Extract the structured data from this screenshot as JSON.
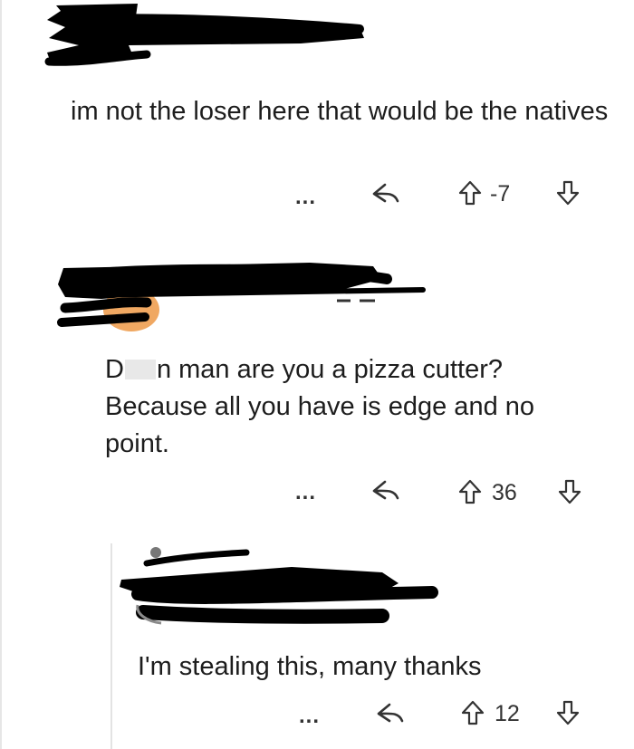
{
  "comments": [
    {
      "text": "im not the loser here that would be the natives",
      "actions": {
        "more_label": "...",
        "score": "-7"
      }
    },
    {
      "text_before": "D",
      "text_after": "n man are you a pizza cutter? Because all you have is edge and no point.",
      "actions": {
        "more_label": "...",
        "score": "36"
      }
    },
    {
      "text": "I'm stealing this, many thanks",
      "actions": {
        "more_label": "...",
        "score": "12"
      }
    }
  ],
  "icons": {
    "more": "more-options-icon",
    "reply": "reply-arrow-icon",
    "upvote": "upvote-arrow-icon",
    "downvote": "downvote-arrow-icon"
  },
  "colors": {
    "text": "#1d1d1d",
    "redaction": "#000000",
    "avatar": "#f0a862"
  }
}
